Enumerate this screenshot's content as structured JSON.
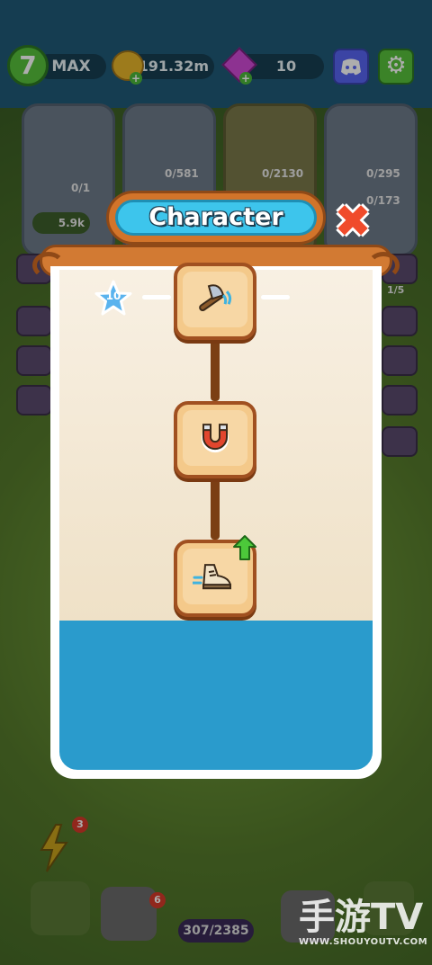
{
  "hud": {
    "level": "7",
    "level_status": "MAX",
    "coins": "191.32m",
    "gems": "10",
    "discord_icon": "discord-icon",
    "settings_icon": "gear-icon"
  },
  "background_cards": [
    {
      "count": "0/1",
      "price": "5.9k"
    },
    {
      "count": "0/581"
    },
    {
      "count": "0/2130"
    },
    {
      "count": "0/295"
    },
    {
      "count": "0/173"
    }
  ],
  "side_label": "1/5",
  "modal": {
    "title": "Character",
    "close_icon": "close-x-icon",
    "star_level": "10",
    "nodes": [
      {
        "icon": "axe-icon"
      },
      {
        "icon": "magnet-icon"
      },
      {
        "icon": "running-shoe-icon",
        "upgradeable": true
      }
    ]
  },
  "bottom": {
    "energy_badge": "3",
    "saw_badge": "6",
    "capacity": "307/2385"
  },
  "watermark": {
    "main": "手游TV",
    "sub": "WWW.SHOUYOUTV.COM"
  },
  "colors": {
    "accent": "#3dc5ec",
    "wood": "#d27a33",
    "water": "#2a9bcc",
    "close": "#f04b2b"
  }
}
